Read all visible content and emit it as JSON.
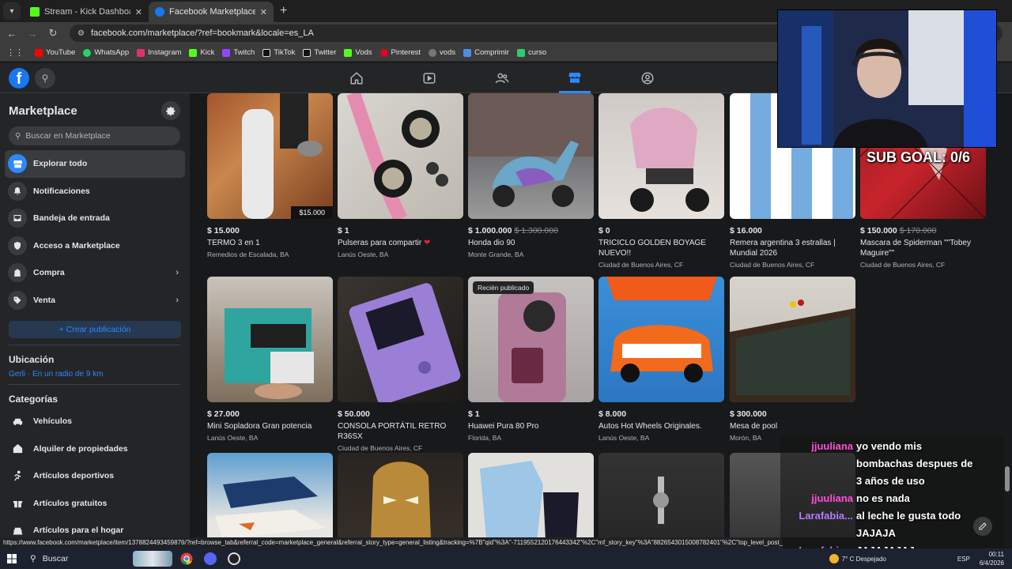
{
  "browser": {
    "tabs": [
      {
        "label": "Stream - Kick Dashboard",
        "favicon": "kick-icon",
        "color": "#53fc18",
        "active": false
      },
      {
        "label": "Facebook Marketplace | Faceboo",
        "favicon": "facebook-icon",
        "color": "#1877f2",
        "active": true
      }
    ],
    "new_tab": "+",
    "url": "facebook.com/marketplace/?ref=bookmark&locale=es_LA",
    "bookmarks": [
      {
        "label": "YouTube",
        "color": "#ff0000"
      },
      {
        "label": "WhatsApp",
        "color": "#25d366"
      },
      {
        "label": "Instagram",
        "color": "#e1306c"
      },
      {
        "label": "Kick",
        "color": "#53fc18"
      },
      {
        "label": "Twitch",
        "color": "#9146ff"
      },
      {
        "label": "TikTok",
        "color": "#ffffff"
      },
      {
        "label": "Twitter",
        "color": "#ffffff"
      },
      {
        "label": "Vods",
        "color": "#53fc18"
      },
      {
        "label": "Pinterest",
        "color": "#e60023"
      },
      {
        "label": "vods",
        "color": "#888888"
      },
      {
        "label": "Comprimir",
        "color": "#4a90e2"
      },
      {
        "label": "curso",
        "color": "#2ecc71"
      }
    ]
  },
  "sidebar": {
    "title": "Marketplace",
    "search_placeholder": "Buscar en Marketplace",
    "items": [
      {
        "label": "Explorar todo",
        "icon": "storefront-icon",
        "active": true,
        "chevron": false
      },
      {
        "label": "Notificaciones",
        "icon": "bell-icon",
        "active": false,
        "chevron": false
      },
      {
        "label": "Bandeja de entrada",
        "icon": "inbox-icon",
        "active": false,
        "chevron": false
      },
      {
        "label": "Acceso a Marketplace",
        "icon": "shield-icon",
        "active": false,
        "chevron": false
      },
      {
        "label": "Compra",
        "icon": "bag-icon",
        "active": false,
        "chevron": true
      },
      {
        "label": "Venta",
        "icon": "tag-icon",
        "active": false,
        "chevron": true
      }
    ],
    "create_label": "+ Crear publicación",
    "location_heading": "Ubicación",
    "location_value": "Gerli · En un radio de 9 km",
    "categories_heading": "Categorías",
    "categories": [
      {
        "label": "Vehículos",
        "icon": "car-icon"
      },
      {
        "label": "Alquiler de propiedades",
        "icon": "house-icon"
      },
      {
        "label": "Artículos deportivos",
        "icon": "runner-icon"
      },
      {
        "label": "Artículos gratuitos",
        "icon": "gift-icon"
      },
      {
        "label": "Artículos para el hogar",
        "icon": "home-goods-icon"
      }
    ]
  },
  "listings": [
    {
      "price": "$ 15.000",
      "old_price": "",
      "title": "TERMO 3 en 1",
      "location": "Remedios de Escalada, BA",
      "badge": "",
      "tag": "$15.000"
    },
    {
      "price": "$ 1",
      "old_price": "",
      "title": "Pulseras para compartir",
      "heart": "❤",
      "location": "Lanús Oeste, BA",
      "badge": "",
      "tag": ""
    },
    {
      "price": "$ 1.000.000",
      "old_price": "$ 1.300.000",
      "title": "Honda dio 90",
      "location": "Monte Grande, BA",
      "badge": "",
      "tag": ""
    },
    {
      "price": "$ 0",
      "old_price": "",
      "title": "TRICICLO GOLDEN BOYAGE NUEVO!!",
      "location": "Ciudad de Buenos Aires, CF",
      "badge": "",
      "tag": ""
    },
    {
      "price": "$ 16.000",
      "old_price": "",
      "title": "Remera argentina 3 estrallas | Mundial 2026",
      "location": "Ciudad de Buenos Aires, CF",
      "badge": "",
      "tag": ""
    },
    {
      "price": "$ 150.000",
      "old_price": "$ 170.000",
      "title": "Mascara de Spiderman \"\"Tobey Maguire\"\"",
      "location": "Ciudad de Buenos Aires, CF",
      "badge": "",
      "tag": ""
    },
    {
      "price": "$ 27.000",
      "old_price": "",
      "title": "Mini Sopladora Gran potencia",
      "location": "Lanús Oeste, BA",
      "badge": "",
      "tag": ""
    },
    {
      "price": "$ 50.000",
      "old_price": "",
      "title": "CONSOLA PORTÁTIL RETRO R36SX",
      "location": "Ciudad de Buenos Aires, CF",
      "badge": "",
      "tag": ""
    },
    {
      "price": "$ 1",
      "old_price": "",
      "title": "Huawei Pura 80 Pro",
      "location": "Florida, BA",
      "badge": "Recién publicado",
      "tag": ""
    },
    {
      "price": "$ 8.000",
      "old_price": "",
      "title": "Autos Hot Wheels Originales.",
      "location": "Lanús Oeste, BA",
      "badge": "",
      "tag": ""
    },
    {
      "price": "$ 300.000",
      "old_price": "",
      "title": "Mesa de pool",
      "location": "Morón, BA",
      "badge": "",
      "tag": ""
    }
  ],
  "overlay": {
    "sub_goal": "SUB GOAL: 0/6",
    "chat": [
      {
        "user": "jjuuliana",
        "color": "#ff4fd8",
        "message": "yo vendo mis"
      },
      {
        "user": "",
        "color": "#ff4fd8",
        "message": "bombachas despues de"
      },
      {
        "user": "",
        "color": "#ff4fd8",
        "message": "3 años de uso"
      },
      {
        "user": "jjuuliana",
        "color": "#ff4fd8",
        "message": "no es nada"
      },
      {
        "user": "Larafabia...",
        "color": "#b57bff",
        "message": "al leche le gusta todo"
      },
      {
        "user": "",
        "color": "#b57bff",
        "message": "JAJAJA"
      },
      {
        "user": "Larafabia...",
        "color": "#b57bff",
        "message": "JAJAJAJAJ"
      }
    ]
  },
  "status_url": "https://www.facebook.com/marketplace/item/1378824493459876/?ref=browse_tab&referral_code=marketplace_general&referral_story_type=general_listing&tracking=%7B\"qid\"%3A\"-7119552120176443342\"%2C\"mf_story_key\"%3A\"8826543015008782401\"%2C\"top_level_post_id\"%3A\"8826543015008782401\"%2C\"commerce_rank_obj\"%3A\"%7B%5C\"ta...",
  "taskbar": {
    "search_label": "Buscar",
    "weather": "7° C  Despejado",
    "lang": "ESP",
    "time": "00:11",
    "date": "6/4/2026"
  },
  "colors": {
    "accent": "#2d88ff",
    "fb_blue": "#1877f2",
    "bg": "#18191a",
    "surface": "#242526"
  }
}
